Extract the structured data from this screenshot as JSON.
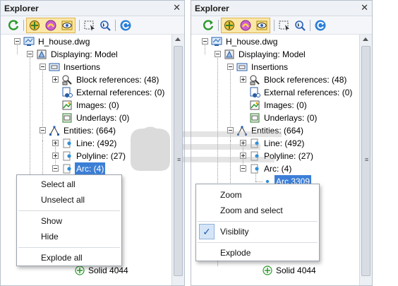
{
  "panels": {
    "left": {
      "title": "Explorer",
      "close": "✕"
    },
    "right": {
      "title": "Explorer",
      "close": "✕"
    }
  },
  "toolbar_icons": [
    "refresh-icon",
    "add-layer-icon",
    "layer-states-icon",
    "visibility-icon",
    "select-window-icon",
    "select-cursor-icon",
    "regen-icon"
  ],
  "tree": {
    "root": "H_house.dwg",
    "displaying": "Displaying: Model",
    "insertions": "Insertions",
    "block_refs": "Block references: (48)",
    "external_refs": "External references: (0)",
    "images": "Images: (0)",
    "underlays": "Underlays: (0)",
    "entities": "Entities: (664)",
    "line": "Line: (492)",
    "polyline": "Polyline: (27)",
    "arc": "Arc: (4)",
    "arc_item": "Arc 3309",
    "solid": "Solid 4044"
  },
  "context_menu_left": {
    "select_all": "Select all",
    "unselect_all": "Unselect all",
    "show": "Show",
    "hide": "Hide",
    "explode_all": "Explode all"
  },
  "context_menu_right": {
    "zoom": "Zoom",
    "zoom_and_select": "Zoom and select",
    "visibility": "Visiblity",
    "visibility_checked": "✓",
    "explode": "Explode"
  },
  "colors": {
    "selection": "#3c7fd6",
    "toolbar_highlight": "#fbe7a8",
    "check_bg": "#d5e5f7"
  }
}
